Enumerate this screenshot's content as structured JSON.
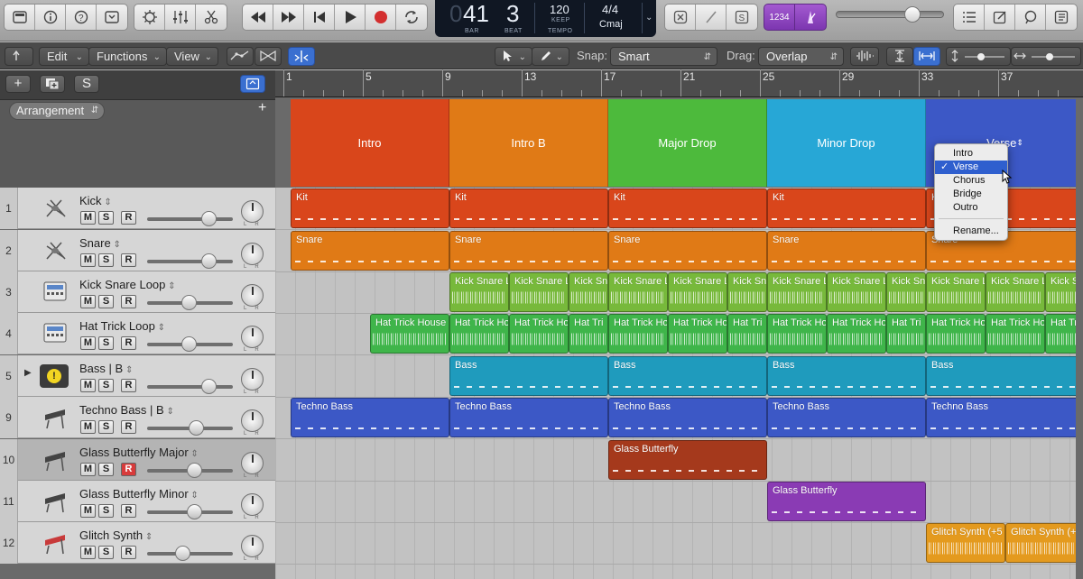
{
  "control_bar": {
    "lcd": {
      "bar": "41",
      "beat": "3",
      "bar_label": "BAR",
      "beat_label": "BEAT",
      "tempo": "120",
      "tempo_mode": "KEEP",
      "tempo_label": "TEMPO",
      "signature": "4/4",
      "key": "Cmaj",
      "bar_ghost": "0"
    },
    "count_in_label": "1234",
    "master_volume": 0.7
  },
  "toolbar": {
    "edit": "Edit",
    "functions": "Functions",
    "view": "View",
    "snap_label": "Snap:",
    "snap_value": "Smart",
    "drag_label": "Drag:",
    "drag_value": "Overlap"
  },
  "header": {
    "add_track": "+",
    "solo_label": "S",
    "arrangement_label": "Arrangement",
    "add_marker": "+"
  },
  "ruler": [
    "1",
    "5",
    "9",
    "13",
    "17",
    "21",
    "25",
    "29",
    "33",
    "37"
  ],
  "markers": [
    {
      "label": "Intro",
      "color": "#d9461b"
    },
    {
      "label": "Intro B",
      "color": "#e07a16"
    },
    {
      "label": "Major Drop",
      "color": "#4dba3c"
    },
    {
      "label": "Minor Drop",
      "color": "#27a7d6"
    },
    {
      "label": "Verse",
      "color": "#3c58c6"
    }
  ],
  "tracks": [
    {
      "num": "1",
      "name": "Kick",
      "rec_on": false,
      "fader": 0.72
    },
    {
      "num": "2",
      "name": "Snare",
      "rec_on": false,
      "fader": 0.72
    },
    {
      "num": "3",
      "name": "Kick Snare Loop",
      "rec_on": false,
      "fader": 0.48
    },
    {
      "num": "4",
      "name": "Hat Trick Loop",
      "rec_on": false,
      "fader": 0.48
    },
    {
      "num": "5",
      "name": "Bass",
      "sub": "B",
      "rec_on": false,
      "fader": 0.72
    },
    {
      "num": "9",
      "name": "Techno Bass",
      "sub": "B",
      "rec_on": false,
      "fader": 0.57
    },
    {
      "num": "10",
      "name": "Glass Butterfly Major",
      "rec_on": true,
      "fader": 0.55
    },
    {
      "num": "11",
      "name": "Glass Butterfly Minor",
      "rec_on": false,
      "fader": 0.55
    },
    {
      "num": "12",
      "name": "Glitch Synth",
      "rec_on": false,
      "fader": 0.41
    }
  ],
  "mute_label": "M",
  "solo_btn_label": "S",
  "rec_label": "R",
  "regions": {
    "kit": "Kit",
    "snare": "Snare",
    "kick_snare_loop": "Kick Snare Loop",
    "kick_sn": "Kick Sn",
    "kic": "Kic",
    "hat_trick_house": "Hat Trick House",
    "hat_tri": "Hat Tri",
    "ha": "Ha",
    "bass": "Bass",
    "techno_bass": "Techno Bass",
    "glass_butterfly": "Glass Butterfly",
    "glitch_synth": "Glitch Synth (+5"
  },
  "popup": {
    "items": [
      "Intro",
      "Verse",
      "Chorus",
      "Bridge",
      "Outro"
    ],
    "selected": "Verse",
    "rename": "Rename..."
  },
  "colors": {
    "kit": "#d9461b",
    "snare": "#e07a16",
    "loop": "#77b93b",
    "hat": "#3fb54a",
    "bass": "#1f9bbd",
    "techno": "#3c58c6",
    "glass_major": "#a5391c",
    "glass_minor": "#8a3bb4",
    "glitch": "#e49a1e"
  }
}
